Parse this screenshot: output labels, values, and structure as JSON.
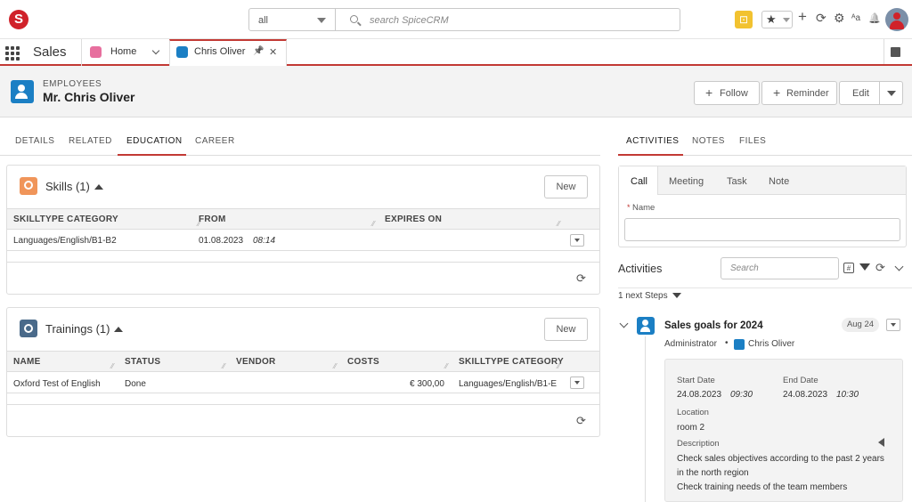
{
  "topbar": {
    "logo_letter": "S",
    "module_select_value": "all",
    "search_placeholder": "search SpiceCRM",
    "calendar_glyph": "⊡",
    "star_glyph": "★",
    "plus_glyph": "+",
    "sync_glyph": "⟳",
    "gear_glyph": "⚙",
    "font_glyph": "ᴬa",
    "bell_glyph": "🔔"
  },
  "tabbar": {
    "app_name": "Sales",
    "tabs": [
      {
        "label": "Home"
      },
      {
        "label": "Chris Oliver"
      }
    ],
    "pin_glyph": "📌",
    "close_glyph": "✕"
  },
  "header": {
    "module": "EMPLOYEES",
    "title": "Mr. Chris Oliver",
    "follow_label": "Follow",
    "reminder_label": "Reminder",
    "edit_label": "Edit"
  },
  "subtabs": [
    "DETAILS",
    "RELATED",
    "EDUCATION",
    "CAREER"
  ],
  "skills": {
    "title": "Skills (1)",
    "new_label": "New",
    "columns": [
      "SKILLTYPE CATEGORY",
      "FROM",
      "EXPIRES ON"
    ],
    "rows": [
      {
        "category": "Languages/English/B1-B2",
        "from_date": "01.08.2023",
        "from_time": "08:14",
        "expires": ""
      }
    ]
  },
  "trainings": {
    "title": "Trainings (1)",
    "new_label": "New",
    "columns": [
      "NAME",
      "STATUS",
      "VENDOR",
      "COSTS",
      "SKILLTYPE CATEGORY"
    ],
    "rows": [
      {
        "name": "Oxford Test of English",
        "status": "Done",
        "vendor": "",
        "costs": "€ 300,00",
        "category": "Languages/English/B1-E"
      }
    ]
  },
  "right_tabs": [
    "ACTIVITIES",
    "NOTES",
    "FILES"
  ],
  "activity_tabs": [
    "Call",
    "Meeting",
    "Task",
    "Note"
  ],
  "call_form": {
    "required_mark": "*",
    "name_label": "Name"
  },
  "activities": {
    "title": "Activities",
    "search_placeholder": "Search",
    "next_steps": "1 next Steps"
  },
  "event": {
    "title": "Sales goals for 2024",
    "date_badge": "Aug 24",
    "assigned": "Administrator",
    "bullet": "•",
    "contact": "Chris Oliver",
    "start_label": "Start Date",
    "start_date": "24.08.2023",
    "start_time": "09:30",
    "end_label": "End Date",
    "end_date": "24.08.2023",
    "end_time": "10:30",
    "location_label": "Location",
    "location": "room 2",
    "description_label": "Description",
    "description_lines": [
      "Check sales objectives according to the past 2 years",
      "in the north region",
      "Check training needs of the team members"
    ]
  },
  "colors": {
    "brand_red": "#d0222a",
    "accent_blue": "#1b7fc4",
    "skills_orange": "#f0955a",
    "trainings_slate": "#4a6a8a"
  }
}
